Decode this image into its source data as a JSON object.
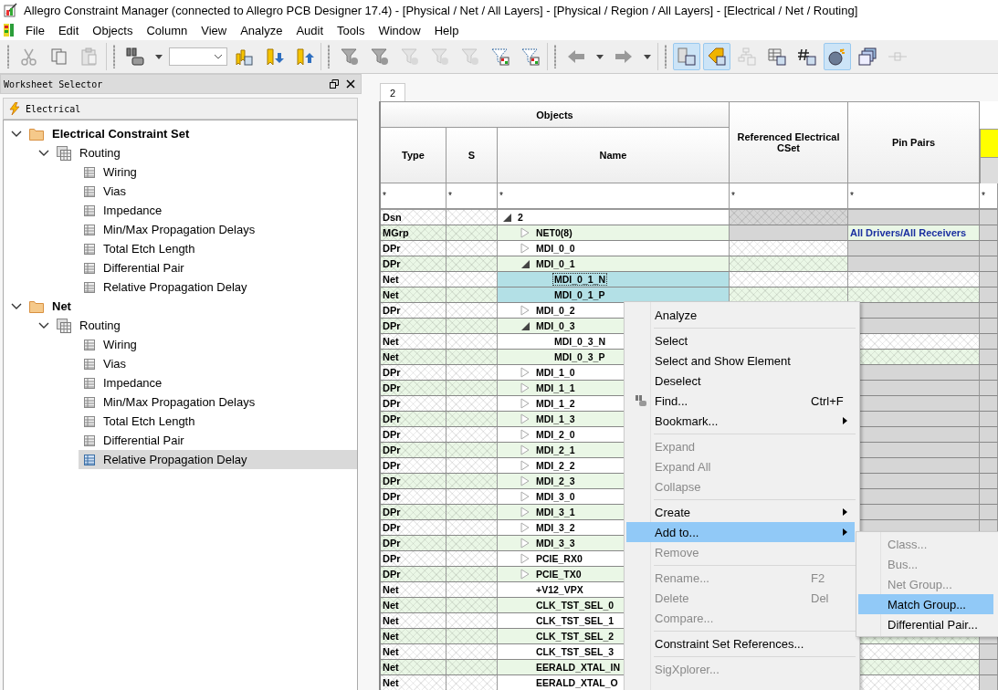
{
  "window": {
    "title": "Allegro Constraint Manager (connected to Allegro PCB Designer 17.4) - [Physical / Net / All Layers] - [Physical / Region / All Layers] - [Electrical / Net / Routing]"
  },
  "menu": [
    "File",
    "Edit",
    "Objects",
    "Column",
    "View",
    "Analyze",
    "Audit",
    "Tools",
    "Window",
    "Help"
  ],
  "toolbar": [
    {
      "kind": "cut",
      "disabled": true,
      "pressed": false
    },
    {
      "kind": "copy",
      "disabled": false,
      "pressed": false
    },
    {
      "kind": "paste",
      "disabled": true,
      "pressed": false
    },
    {
      "kind": "sep"
    },
    {
      "kind": "find",
      "disabled": false,
      "pressed": false
    },
    {
      "kind": "combo"
    },
    {
      "kind": "bookmarks",
      "disabled": false,
      "pressed": false
    },
    {
      "kind": "bookmark-down",
      "disabled": false,
      "pressed": false
    },
    {
      "kind": "bookmark-up",
      "disabled": false,
      "pressed": false
    },
    {
      "kind": "sep"
    },
    {
      "kind": "filter",
      "disabled": false,
      "pressed": false
    },
    {
      "kind": "filter",
      "disabled": false,
      "pressed": false
    },
    {
      "kind": "filter",
      "disabled": true,
      "pressed": false
    },
    {
      "kind": "filter",
      "disabled": true,
      "pressed": false
    },
    {
      "kind": "filter",
      "disabled": true,
      "pressed": false
    },
    {
      "kind": "filter-color",
      "disabled": false,
      "pressed": false
    },
    {
      "kind": "filter-color",
      "disabled": false,
      "pressed": false
    },
    {
      "kind": "sep"
    },
    {
      "kind": "back",
      "disabled": false,
      "pressed": false
    },
    {
      "kind": "forward",
      "disabled": false,
      "pressed": false
    },
    {
      "kind": "sep"
    },
    {
      "kind": "table",
      "disabled": false,
      "pressed": true
    },
    {
      "kind": "tag",
      "disabled": false,
      "pressed": true
    },
    {
      "kind": "hierarchy",
      "disabled": true,
      "pressed": false
    },
    {
      "kind": "grid",
      "disabled": false,
      "pressed": false
    },
    {
      "kind": "hash",
      "disabled": false,
      "pressed": false
    },
    {
      "kind": "sun",
      "disabled": false,
      "pressed": true
    },
    {
      "kind": "windows",
      "disabled": false,
      "pressed": false
    },
    {
      "kind": "connector",
      "disabled": true,
      "pressed": false
    }
  ],
  "worksheet_selector": {
    "title": "Worksheet Selector",
    "tab": "Electrical",
    "tree": [
      {
        "label": "Electrical Constraint Set",
        "kind": "folder",
        "expanded": true,
        "selected": false,
        "children": [
          {
            "label": "Routing",
            "kind": "group",
            "expanded": true,
            "selected": false,
            "children": [
              {
                "label": "Wiring",
                "kind": "sheet",
                "selected": false
              },
              {
                "label": "Vias",
                "kind": "sheet",
                "selected": false
              },
              {
                "label": "Impedance",
                "kind": "sheet",
                "selected": false
              },
              {
                "label": "Min/Max Propagation Delays",
                "kind": "sheet",
                "selected": false
              },
              {
                "label": "Total Etch Length",
                "kind": "sheet",
                "selected": false
              },
              {
                "label": "Differential Pair",
                "kind": "sheet",
                "selected": false
              },
              {
                "label": "Relative Propagation Delay",
                "kind": "sheet",
                "selected": false
              }
            ]
          }
        ]
      },
      {
        "label": "Net",
        "kind": "folder",
        "expanded": true,
        "selected": false,
        "children": [
          {
            "label": "Routing",
            "kind": "group",
            "expanded": true,
            "selected": false,
            "children": [
              {
                "label": "Wiring",
                "kind": "sheet",
                "selected": false
              },
              {
                "label": "Vias",
                "kind": "sheet",
                "selected": false
              },
              {
                "label": "Impedance",
                "kind": "sheet",
                "selected": false
              },
              {
                "label": "Min/Max Propagation Delays",
                "kind": "sheet",
                "selected": false
              },
              {
                "label": "Total Etch Length",
                "kind": "sheet",
                "selected": false
              },
              {
                "label": "Differential Pair",
                "kind": "sheet",
                "selected": false
              },
              {
                "label": "Relative Propagation Delay",
                "kind": "sheet",
                "selected": true
              }
            ]
          }
        ]
      }
    ]
  },
  "worksheet": {
    "tab": "2",
    "columns": {
      "group": "Objects",
      "type": "Type",
      "s": "S",
      "name": "Name",
      "cset": "Referenced Electrical CSet",
      "pin_pairs": "Pin Pairs"
    },
    "filters": [
      "*",
      "*",
      "*",
      "*",
      "*",
      "*"
    ],
    "rows": [
      {
        "kind": "design",
        "type": "Dsn",
        "name": "2",
        "expanded": true,
        "selected": false,
        "children": [
          {
            "kind": "match-group",
            "type": "MGrp",
            "name": "NET0(8)",
            "expanded": false,
            "selected": false,
            "pin_pairs": "All Drivers/All Receivers"
          },
          {
            "kind": "diff-pair",
            "type": "DPr",
            "name": "MDI_0_0",
            "expanded": false,
            "selected": false
          },
          {
            "kind": "diff-pair",
            "type": "DPr",
            "name": "MDI_0_1",
            "expanded": true,
            "selected": false,
            "children": [
              {
                "kind": "net",
                "type": "Net",
                "name": "MDI_0_1_N",
                "selected": true
              },
              {
                "kind": "net",
                "type": "Net",
                "name": "MDI_0_1_P",
                "selected": true
              }
            ]
          },
          {
            "kind": "diff-pair",
            "type": "DPr",
            "name": "MDI_0_2",
            "expanded": false,
            "selected": false
          },
          {
            "kind": "diff-pair",
            "type": "DPr",
            "name": "MDI_0_3",
            "expanded": true,
            "selected": false,
            "children": [
              {
                "kind": "net",
                "type": "Net",
                "name": "MDI_0_3_N",
                "selected": false
              },
              {
                "kind": "net",
                "type": "Net",
                "name": "MDI_0_3_P",
                "selected": false
              }
            ]
          },
          {
            "kind": "diff-pair",
            "type": "DPr",
            "name": "MDI_1_0",
            "expanded": false,
            "selected": false
          },
          {
            "kind": "diff-pair",
            "type": "DPr",
            "name": "MDI_1_1",
            "expanded": false,
            "selected": false
          },
          {
            "kind": "diff-pair",
            "type": "DPr",
            "name": "MDI_1_2",
            "expanded": false,
            "selected": false
          },
          {
            "kind": "diff-pair",
            "type": "DPr",
            "name": "MDI_1_3",
            "expanded": false,
            "selected": false
          },
          {
            "kind": "diff-pair",
            "type": "DPr",
            "name": "MDI_2_0",
            "expanded": false,
            "selected": false
          },
          {
            "kind": "diff-pair",
            "type": "DPr",
            "name": "MDI_2_1",
            "expanded": false,
            "selected": false
          },
          {
            "kind": "diff-pair",
            "type": "DPr",
            "name": "MDI_2_2",
            "expanded": false,
            "selected": false
          },
          {
            "kind": "diff-pair",
            "type": "DPr",
            "name": "MDI_2_3",
            "expanded": false,
            "selected": false
          },
          {
            "kind": "diff-pair",
            "type": "DPr",
            "name": "MDI_3_0",
            "expanded": false,
            "selected": false
          },
          {
            "kind": "diff-pair",
            "type": "DPr",
            "name": "MDI_3_1",
            "expanded": false,
            "selected": false
          },
          {
            "kind": "diff-pair",
            "type": "DPr",
            "name": "MDI_3_2",
            "expanded": false,
            "selected": false
          },
          {
            "kind": "diff-pair",
            "type": "DPr",
            "name": "MDI_3_3",
            "expanded": false,
            "selected": false
          },
          {
            "kind": "diff-pair",
            "type": "DPr",
            "name": "PCIE_RX0",
            "expanded": false,
            "selected": false
          },
          {
            "kind": "diff-pair",
            "type": "DPr",
            "name": "PCIE_TX0",
            "expanded": false,
            "selected": false
          },
          {
            "kind": "net",
            "type": "Net",
            "name": "+V12_VPX",
            "selected": false
          },
          {
            "kind": "net",
            "type": "Net",
            "name": "CLK_TST_SEL_0",
            "selected": false
          },
          {
            "kind": "net",
            "type": "Net",
            "name": "CLK_TST_SEL_1",
            "selected": false
          },
          {
            "kind": "net",
            "type": "Net",
            "name": "CLK_TST_SEL_2",
            "selected": false
          },
          {
            "kind": "net",
            "type": "Net",
            "name": "CLK_TST_SEL_3",
            "selected": false
          },
          {
            "kind": "net",
            "type": "Net",
            "name": "EERALD_XTAL_IN",
            "selected": false
          },
          {
            "kind": "net",
            "type": "Net",
            "name": "EERALD_XTAL_O",
            "selected": false
          }
        ]
      }
    ]
  },
  "context_menu": [
    {
      "kind": "item",
      "label": "Analyze",
      "disabled": false,
      "selected": false
    },
    {
      "kind": "separator"
    },
    {
      "kind": "item",
      "label": "Select",
      "disabled": false,
      "selected": false
    },
    {
      "kind": "item",
      "label": "Select and Show Element",
      "disabled": false,
      "selected": false
    },
    {
      "kind": "item",
      "label": "Deselect",
      "disabled": false,
      "selected": false
    },
    {
      "kind": "icon-item",
      "label": "Find...",
      "shortcut": "Ctrl+F",
      "disabled": false,
      "selected": false
    },
    {
      "kind": "item",
      "label": "Bookmark...",
      "submenu": true,
      "disabled": false,
      "selected": false
    },
    {
      "kind": "separator"
    },
    {
      "kind": "item",
      "label": "Expand",
      "disabled": true,
      "selected": false
    },
    {
      "kind": "item",
      "label": "Expand All",
      "disabled": true,
      "selected": false
    },
    {
      "kind": "item",
      "label": "Collapse",
      "disabled": true,
      "selected": false
    },
    {
      "kind": "separator"
    },
    {
      "kind": "item",
      "label": "Create",
      "submenu": true,
      "disabled": false,
      "selected": false
    },
    {
      "kind": "item",
      "label": "Add to...",
      "submenu": true,
      "disabled": false,
      "selected": true
    },
    {
      "kind": "item",
      "label": "Remove",
      "disabled": true,
      "selected": false
    },
    {
      "kind": "separator"
    },
    {
      "kind": "item",
      "label": "Rename...",
      "shortcut": "F2",
      "disabled": true,
      "selected": false
    },
    {
      "kind": "item",
      "label": "Delete",
      "shortcut": "Del",
      "disabled": true,
      "selected": false
    },
    {
      "kind": "item",
      "label": "Compare...",
      "disabled": true,
      "selected": false
    },
    {
      "kind": "separator"
    },
    {
      "kind": "item",
      "label": "Constraint Set References...",
      "disabled": false,
      "selected": false
    },
    {
      "kind": "separator"
    },
    {
      "kind": "item",
      "label": "SigXplorer...",
      "disabled": true,
      "selected": false
    }
  ],
  "submenu": [
    {
      "label": "Class...",
      "disabled": true,
      "selected": false
    },
    {
      "label": "Bus...",
      "disabled": true,
      "selected": false
    },
    {
      "label": "Net Group...",
      "disabled": true,
      "selected": false
    },
    {
      "label": "Match Group...",
      "disabled": false,
      "selected": true
    },
    {
      "label": "Differential Pair...",
      "disabled": false,
      "selected": false
    }
  ]
}
